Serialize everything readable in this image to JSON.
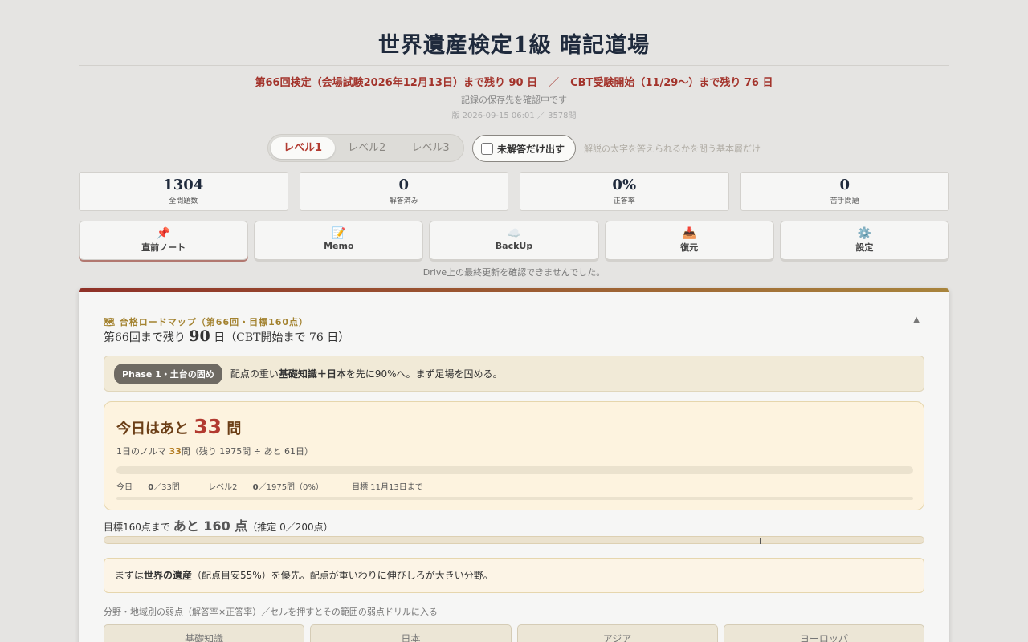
{
  "header": {
    "title": "世界遺産検定1級 暗記道場",
    "countdown_main": "第66回検定（会場試験2026年12月13日）まで残り 90 日",
    "countdown_sep": "／",
    "countdown_cbt": "CBT受験開始（11/29〜）まで残り 76 日",
    "save_status": "記録の保存先を確認中です",
    "version": "版 2026-09-15 06:01 ／ 3578問"
  },
  "controls": {
    "level_tabs": [
      "レベル1",
      "レベル2",
      "レベル3"
    ],
    "active_level": "レベル1",
    "unanswered_label": "未解答だけ出す",
    "unanswered_checked": false,
    "hint": "解説の太字を答えられるかを問う基本層だけ"
  },
  "stats": [
    {
      "value": "1304",
      "label": "全問題数"
    },
    {
      "value": "0",
      "label": "解答済み"
    },
    {
      "value": "0%",
      "label": "正答率"
    },
    {
      "value": "0",
      "label": "苦手問題"
    }
  ],
  "actions": [
    {
      "icon": "📌",
      "icon_name": "pin-icon",
      "label": "直前ノート"
    },
    {
      "icon": "📝",
      "icon_name": "memo-icon",
      "label": "Memo"
    },
    {
      "icon": "☁️",
      "icon_name": "cloud-icon",
      "label": "BackUp"
    },
    {
      "icon": "📥",
      "icon_name": "inbox-icon",
      "label": "復元"
    },
    {
      "icon": "⚙️",
      "icon_name": "gear-icon",
      "label": "設定"
    }
  ],
  "drive_note": "Drive上の最終更新を確認できませんでした。",
  "roadmap": {
    "title": "🗺 合格ロードマップ（第66回・目標160点）",
    "collapse_icon": "▲",
    "remain_prefix": "第66回まで残り",
    "remain_days": "90",
    "remain_suffix": "日（CBT開始まで 76 日）",
    "phase_badge": "Phase 1・土台の固め",
    "phase_text_pre": "配点の重い",
    "phase_text_bold": "基礎知識＋日本",
    "phase_text_post": "を先に90%へ。まず足場を固める。",
    "today": {
      "head_pre": "今日はあと",
      "count": "33",
      "head_post": "問",
      "quota_pre": "1日のノルマ",
      "quota_value": "33",
      "quota_post": "問（残り 1975問 ÷ あと 61日）",
      "progress_fraction": 0,
      "today_pre": "今日",
      "today_done": "0",
      "today_post": "／33問",
      "level2_pre": "レベル2",
      "level2_done": "0",
      "level2_post": "／1975問（0%）",
      "goal": "目標 11月13日まで"
    },
    "target": {
      "pre": "目標160点まで",
      "big": "あと 160 点",
      "post": "（推定 0／200点）",
      "score_estimate": 0,
      "score_target": 160,
      "score_max": 200
    },
    "advice_pre": "まずは",
    "advice_bold": "世界の遺産",
    "advice_post": "（配点目安55%）を優先。配点が重いわりに伸びしろが大きい分野。",
    "weak_note": "分野・地域別の弱点（解答率×正答率）／セルを押すとその範囲の弱点ドリルに入る",
    "weak_cells": [
      "基礎知識",
      "日本",
      "アジア",
      "ヨーロッパ"
    ]
  },
  "colors": {
    "accent_red": "#b23a30",
    "accent_gold": "#a3822f",
    "navy": "#1f2a3c"
  }
}
